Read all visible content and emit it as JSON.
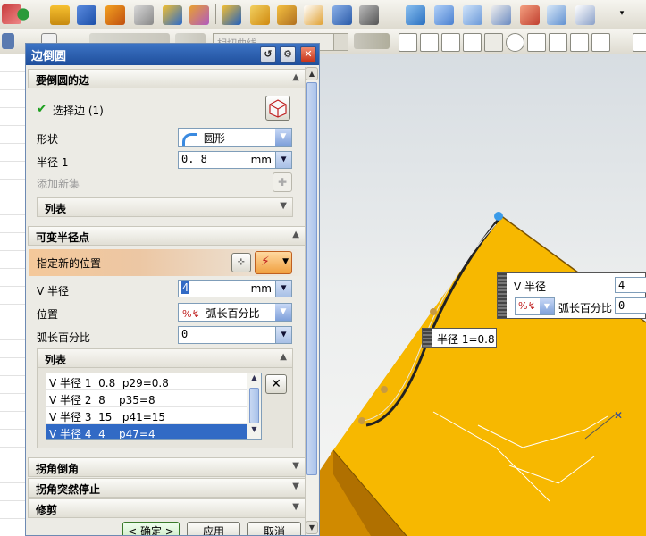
{
  "dialog": {
    "title": "边倒圆",
    "sections": {
      "edges": {
        "header": "要倒圆的边",
        "select_edge": "选择边 (1)",
        "shape_label": "形状",
        "shape_value": "圆形",
        "radius_label": "半径 1",
        "radius_value": "0. 8",
        "radius_unit": "mm",
        "add_new_set": "添加新集",
        "list_label": "列表"
      },
      "variable": {
        "header": "可变半径点",
        "specify_location": "指定新的位置",
        "v_radius_label": "V 半径",
        "v_radius_value": "4",
        "v_radius_unit": "mm",
        "position_label": "位置",
        "position_value": "弧长百分比",
        "arc_percent_label": "弧长百分比",
        "arc_percent_value": "0",
        "list_label": "列表",
        "list_rows": [
          {
            "name": "V 半径 1",
            "value": "0.8",
            "expr": "p29=0.8"
          },
          {
            "name": "V 半径 2",
            "value": "8",
            "expr": "p35=8"
          },
          {
            "name": "V 半径 3",
            "value": "15",
            "expr": "p41=15"
          },
          {
            "name": "V 半径 4",
            "value": "4",
            "expr": "p47=4"
          }
        ]
      },
      "corner_chamfer": "拐角倒角",
      "corner_stop": "拐角突然停止",
      "trim": "修剪"
    },
    "buttons": {
      "ok": "< 确定 >",
      "apply": "应用",
      "cancel": "取消"
    }
  },
  "toolbar": {
    "combo_text": "相切曲线"
  },
  "viewport": {
    "callout_vradius": {
      "label": "V 半径",
      "value": "4",
      "position_value": "弧长百分比",
      "arc_value": "0"
    },
    "radius_tag": "半径 1=0.8"
  },
  "colors": {
    "title_bar": "#2b5fb0",
    "solid_body": "#f2b400",
    "highlight": "#f4c89a",
    "selection": "#316ac5"
  }
}
